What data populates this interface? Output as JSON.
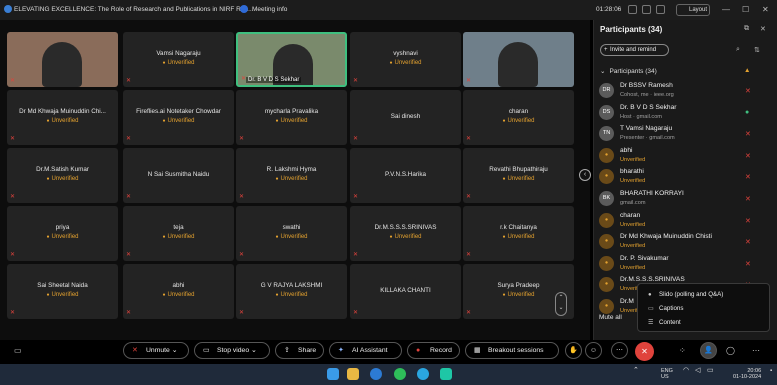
{
  "topbar": {
    "meeting_title": "ELEVATING EXCELLENCE: The Role of Research and Publications in NIRF Ran...",
    "meeting_info": "Meeting info",
    "timer": "01:28:06",
    "layout_label": "Layout"
  },
  "tiles": [
    {
      "name": "",
      "status": "",
      "video": true
    },
    {
      "name": "Vamsi Nagaraju",
      "status": "Unverified"
    },
    {
      "name": "Dr. B V D S Sekhar",
      "status": "",
      "video": true,
      "active": true
    },
    {
      "name": "vyshnavi",
      "status": "Unverified"
    },
    {
      "name": "",
      "status": "",
      "video": true
    },
    {
      "name": "Dr Md Khwaja Muinuddin Chi...",
      "status": "Unverified"
    },
    {
      "name": "Fireflies.ai Notetaker Chowdar",
      "status": "Unverified"
    },
    {
      "name": "mycharla Pravalika",
      "status": "Unverified"
    },
    {
      "name": "Sai dinesh",
      "status": ""
    },
    {
      "name": "charan",
      "status": "Unverified"
    },
    {
      "name": "Dr.M.Satish Kumar",
      "status": "Unverified"
    },
    {
      "name": "N Sai Susmitha Naidu",
      "status": ""
    },
    {
      "name": "R. Lakshmi Hyma",
      "status": "Unverified"
    },
    {
      "name": "P.V.N.S.Harika",
      "status": ""
    },
    {
      "name": "Revathi Bhupathiraju",
      "status": "Unverified"
    },
    {
      "name": "priya",
      "status": "Unverified"
    },
    {
      "name": "teja",
      "status": "Unverified"
    },
    {
      "name": "swathi",
      "status": "Unverified"
    },
    {
      "name": "Dr.M.S.S.S.SRINIVAS",
      "status": "Unverified"
    },
    {
      "name": "r.k Chaitanya",
      "status": "Unverified"
    },
    {
      "name": "Sai Sheetal Naida",
      "status": "Unverified"
    },
    {
      "name": "abhi",
      "status": "Unverified"
    },
    {
      "name": "G V RAJYA LAKSHMI",
      "status": "Unverified"
    },
    {
      "name": "KILLAKA CHANTI",
      "status": ""
    },
    {
      "name": "Surya Pradeep",
      "status": "Unverified"
    }
  ],
  "panel": {
    "title": "Participants (34)",
    "invite_label": "Invite and remind",
    "section_label": "Participants (34)",
    "mute_all": "Mute all",
    "participants": [
      {
        "initials": "DR",
        "name": "Dr BSSV Ramesh",
        "sub": "Cohost, me · ieee.org",
        "unverified": false,
        "mic": "red"
      },
      {
        "initials": "DS",
        "name": "Dr. B V D S Sekhar",
        "sub": "Host · gmail.com",
        "unverified": false,
        "mic": "green"
      },
      {
        "initials": "TN",
        "name": "T Vamsi Nagaraju",
        "sub": "Presenter · gmail.com",
        "unverified": false,
        "mic": "red"
      },
      {
        "initials": "",
        "name": "abhi",
        "sub": "Unverified",
        "unverified": true,
        "mic": "red"
      },
      {
        "initials": "",
        "name": "bharathi",
        "sub": "Unverified",
        "unverified": true,
        "mic": "red"
      },
      {
        "initials": "BK",
        "name": "BHARATHI KORRAYI",
        "sub": "gmail.com",
        "unverified": false,
        "mic": "red"
      },
      {
        "initials": "",
        "name": "charan",
        "sub": "Unverified",
        "unverified": true,
        "mic": "red"
      },
      {
        "initials": "",
        "name": "Dr Md Khwaja Muinuddin Chisti",
        "sub": "Unverified",
        "unverified": true,
        "mic": "red"
      },
      {
        "initials": "",
        "name": "Dr. P. Sivakumar",
        "sub": "Unverified",
        "unverified": true,
        "mic": "red"
      },
      {
        "initials": "",
        "name": "Dr.M.S.S.S.SRINIVAS",
        "sub": "Unverified",
        "unverified": true,
        "mic": "red"
      },
      {
        "initials": "",
        "name": "Dr.M",
        "sub": "Unverified",
        "unverified": true,
        "mic": "red"
      }
    ]
  },
  "popup": {
    "items": [
      "Slido (polling and Q&A)",
      "Captions",
      "Content"
    ]
  },
  "controls": {
    "unmute": "Unmute",
    "stop_video": "Stop video",
    "share": "Share",
    "ai_assistant": "AI Assistant",
    "record": "Record",
    "breakout": "Breakout sessions"
  },
  "taskbar": {
    "lang": "ENG",
    "region": "US",
    "time": "20:06",
    "date": "01-10-2024"
  }
}
